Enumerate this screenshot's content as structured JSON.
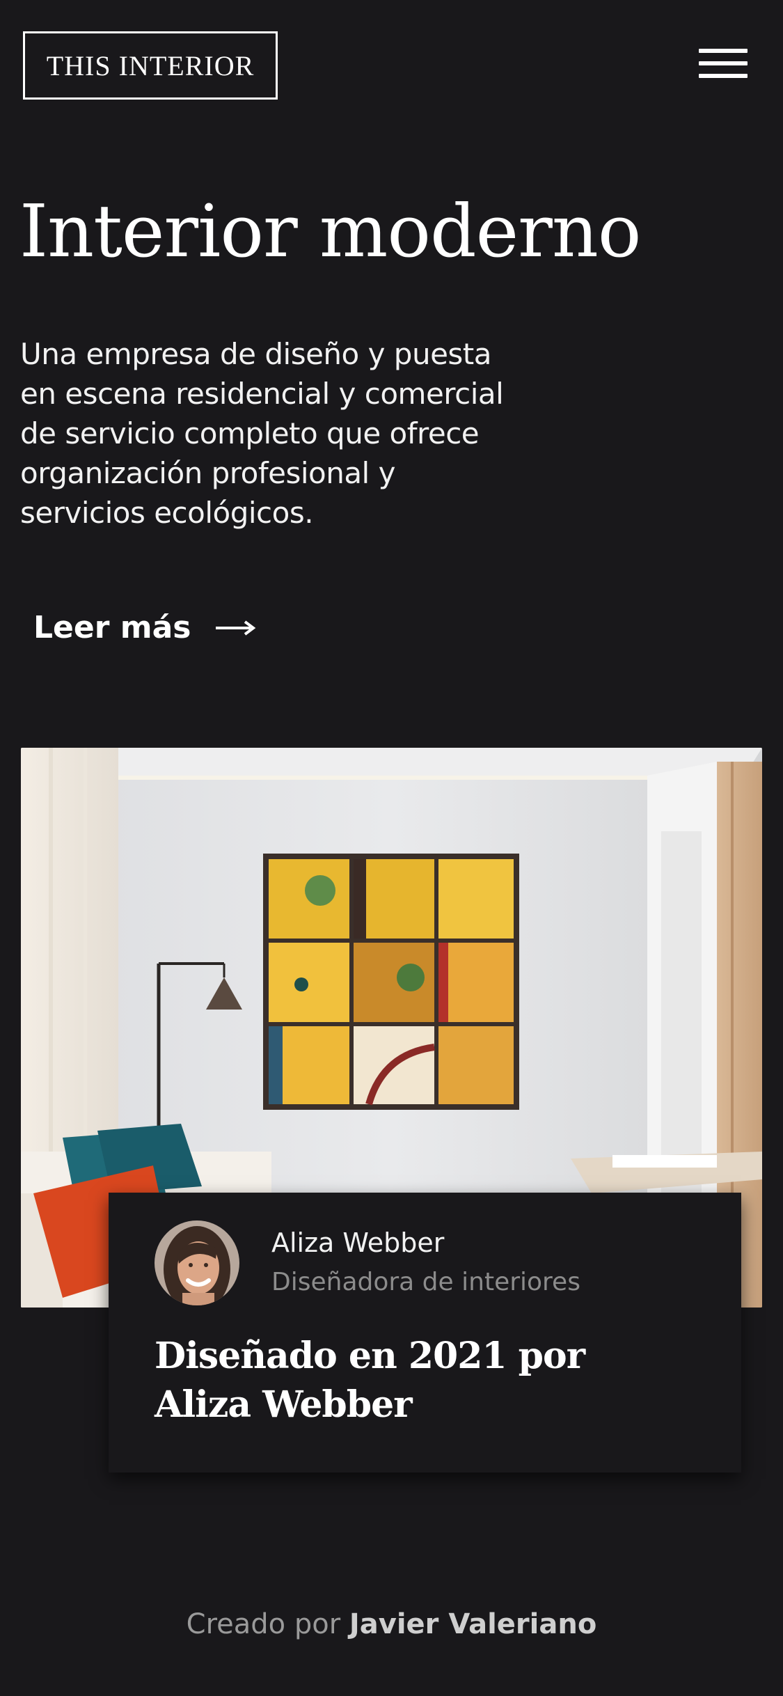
{
  "header": {
    "logo_text": "THIS INTERIOR",
    "menu_icon": "hamburger-menu-icon"
  },
  "hero": {
    "title": "Interior moderno",
    "description": "Una empresa de diseño y puesta en escena residencial y comercial de servicio completo que ofrece organización profesional y servicios ecológicos.",
    "cta_label": "Leer más",
    "cta_icon": "arrow-right-icon"
  },
  "feature_card": {
    "author_name": "Aliza Webber",
    "author_role": "Diseñadora de interiores",
    "title": "Diseñado en 2021 por Aliza Webber"
  },
  "footer": {
    "prefix": "Creado por",
    "author": "Javier Valeriano"
  },
  "colors": {
    "background": "#19181b",
    "text": "#ffffff",
    "muted": "#8c8c8c"
  }
}
